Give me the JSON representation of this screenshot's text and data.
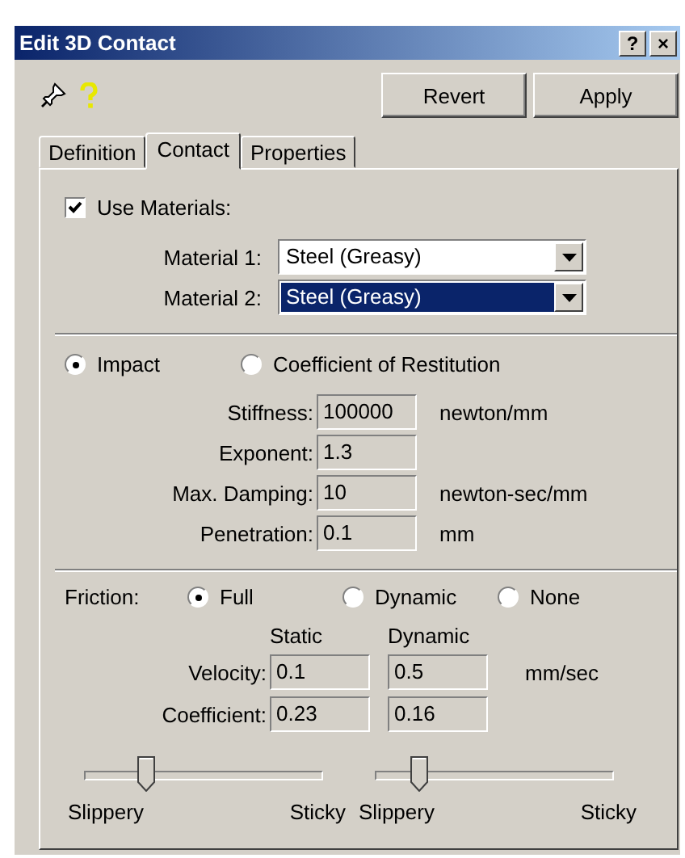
{
  "window": {
    "title": "Edit 3D Contact",
    "title_buttons": [
      "?",
      "×"
    ]
  },
  "toolbar": {
    "buttons": [
      "Revert",
      "Apply"
    ]
  },
  "tabs": [
    {
      "label": "Definition",
      "selected": false
    },
    {
      "label": "Contact",
      "selected": true
    },
    {
      "label": "Properties",
      "selected": false
    }
  ],
  "use_materials": {
    "label": "Use Materials:",
    "checked": true
  },
  "materials": [
    {
      "label": "Material 1:",
      "value": "Steel (Greasy)",
      "focused": false
    },
    {
      "label": "Material 2:",
      "value": "Steel (Greasy)",
      "focused": true
    }
  ],
  "contact_model": [
    {
      "label": "Impact",
      "selected": true
    },
    {
      "label": "Coefficient of Restitution",
      "selected": false
    }
  ],
  "impact_fields": [
    {
      "label": "Stiffness:",
      "value": "100000",
      "unit": "newton/mm"
    },
    {
      "label": "Exponent:",
      "value": "1.3"
    },
    {
      "label": "Max. Damping:",
      "value": "10",
      "unit": "newton-sec/mm"
    },
    {
      "label": "Penetration:",
      "value": "0.1",
      "unit": "mm"
    }
  ],
  "friction": {
    "label": "Friction:",
    "options": [
      {
        "label": "Full",
        "selected": true
      },
      {
        "label": "Dynamic",
        "selected": false
      },
      {
        "label": "None",
        "selected": false
      }
    ],
    "columns": [
      "Static",
      "Dynamic"
    ],
    "rows": [
      {
        "label": "Velocity:",
        "static": "0.1",
        "dynamic": "0.5",
        "unit": "mm/sec"
      },
      {
        "label": "Coefficient:",
        "static": "0.23",
        "dynamic": "0.16"
      }
    ],
    "sliders": [
      {
        "level": 0.25,
        "left_label": "Slippery",
        "right_label": "Sticky"
      },
      {
        "level": 0.18,
        "left_label": "Slippery",
        "right_label": "Sticky"
      }
    ]
  }
}
